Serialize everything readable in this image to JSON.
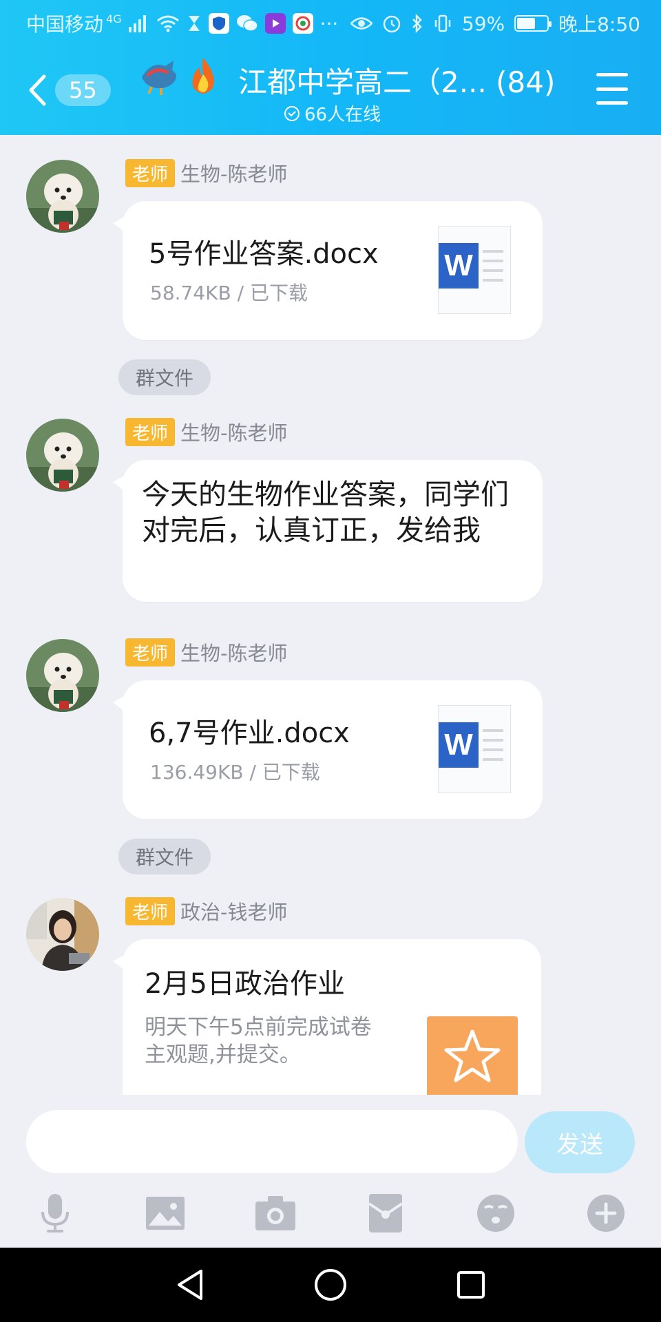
{
  "status_bar": {
    "carrier": "中国移动",
    "network": "4G",
    "battery": "59%",
    "time": "晚上8:50"
  },
  "header": {
    "back_count": "55",
    "title": "江都中学高二（2... (84)",
    "online": "66人在线"
  },
  "messages": [
    {
      "role": "老师",
      "sender": "生物-陈老师",
      "file_name": "5号作业答案.docx",
      "file_meta": "58.74KB / 已下载",
      "tag": "群文件"
    },
    {
      "role": "老师",
      "sender": "生物-陈老师",
      "text": "今天的生物作业答案，同学们对完后，认真订正，发给我"
    },
    {
      "role": "老师",
      "sender": "生物-陈老师",
      "file_name": "6,7号作业.docx",
      "file_meta": "136.49KB / 已下载",
      "tag": "群文件"
    },
    {
      "role": "老师",
      "sender": "政治-钱老师",
      "task_title": "2月5日政治作业",
      "task_desc": "明天下午5点前完成试卷主观题,并提交。"
    }
  ],
  "input": {
    "placeholder": "",
    "send_label": "发送"
  },
  "toolbar_icons": [
    "microphone-icon",
    "image-icon",
    "camera-icon",
    "red-packet-icon",
    "emoji-icon",
    "plus-icon"
  ],
  "colors": {
    "header": "#14b8f7",
    "role_badge": "#f7b731",
    "word": "#2b63c6",
    "task_icon": "#f8a65c",
    "send_disabled": "#b9e8fb"
  }
}
